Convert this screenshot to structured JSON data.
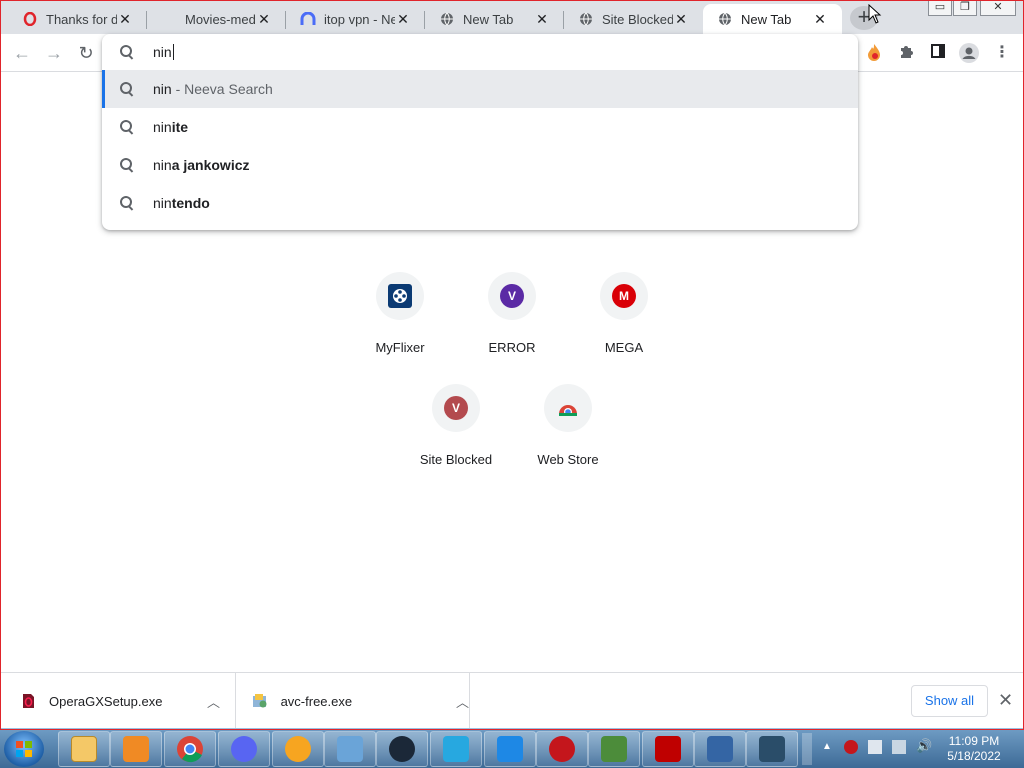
{
  "tabs": [
    {
      "title": "Thanks for do",
      "icon": "opera-icon"
    },
    {
      "title": "Movies-media",
      "icon": "blank-icon"
    },
    {
      "title": "itop vpn - New",
      "icon": "vpn-icon"
    },
    {
      "title": "New Tab",
      "icon": "globe-icon"
    },
    {
      "title": "Site Blocked",
      "icon": "globe-icon"
    },
    {
      "title": "New Tab",
      "icon": "globe-icon",
      "active": true
    }
  ],
  "omnibox": {
    "query": "nin",
    "suggestions": [
      {
        "typed": "nin",
        "completion": "",
        "sub": " - Neeva Search"
      },
      {
        "typed": "nin",
        "completion": "ite",
        "sub": ""
      },
      {
        "typed": "nin",
        "completion": "a jankowicz",
        "sub": ""
      },
      {
        "typed": "nin",
        "completion": "tendo",
        "sub": ""
      }
    ]
  },
  "shortcuts": [
    {
      "label": "MyFlixer",
      "letter": "",
      "color": "#0b3a73"
    },
    {
      "label": "ERROR",
      "letter": "V",
      "color": "#5b2aa5"
    },
    {
      "label": "MEGA",
      "letter": "M",
      "color": "#d90007"
    },
    {
      "label": "Site Blocked",
      "letter": "V",
      "color": "#b34a4e"
    },
    {
      "label": "Web Store",
      "letter": "",
      "color": "#4285f4"
    }
  ],
  "downloads": [
    {
      "name": "OperaGXSetup.exe"
    },
    {
      "name": "avc-free.exe"
    }
  ],
  "download_bar": {
    "show_all": "Show all"
  },
  "clock": {
    "time": "11:09 PM",
    "date": "5/18/2022"
  },
  "colors": {
    "accent": "#1a73e8",
    "window_border": "#e0242b"
  }
}
